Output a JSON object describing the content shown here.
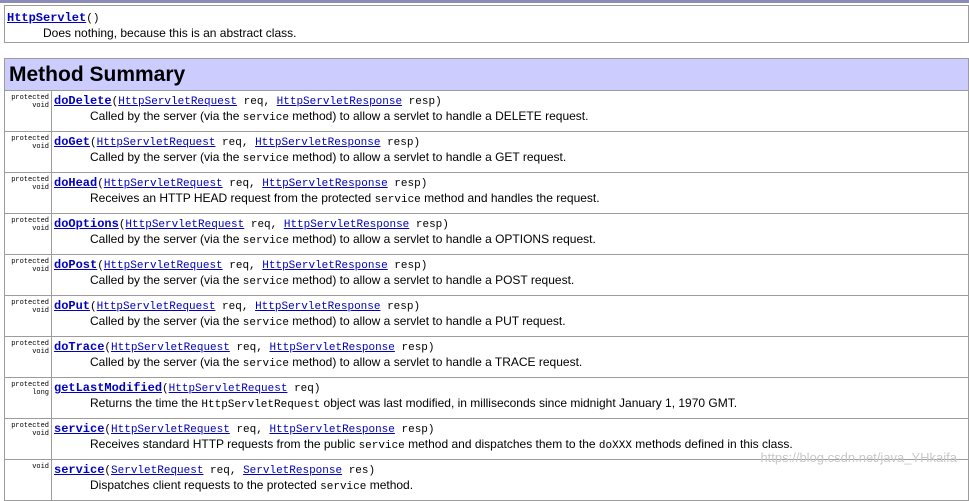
{
  "constructor": {
    "name": "HttpServlet",
    "params": "()",
    "description": "Does nothing, because this is an abstract class."
  },
  "summary_title": "Method Summary",
  "methods": [
    {
      "modifier": [
        "protected",
        "void"
      ],
      "name": "doDelete",
      "p1type": "HttpServletRequest",
      "p1name": " req, ",
      "p2type": "HttpServletResponse",
      "p2name": " resp)",
      "desc": [
        "Called by the server (via the ",
        "service",
        " method) to allow a servlet to handle a DELETE request."
      ]
    },
    {
      "modifier": [
        "protected",
        "void"
      ],
      "name": "doGet",
      "p1type": "HttpServletRequest",
      "p1name": " req, ",
      "p2type": "HttpServletResponse",
      "p2name": " resp)",
      "desc": [
        "Called by the server (via the ",
        "service",
        " method) to allow a servlet to handle a GET request."
      ]
    },
    {
      "modifier": [
        "protected",
        "void"
      ],
      "name": "doHead",
      "p1type": "HttpServletRequest",
      "p1name": " req, ",
      "p2type": "HttpServletResponse",
      "p2name": " resp)",
      "desc": [
        "Receives an HTTP HEAD request from the protected ",
        "service",
        " method and handles the request."
      ]
    },
    {
      "modifier": [
        "protected",
        "void"
      ],
      "name": "doOptions",
      "p1type": "HttpServletRequest",
      "p1name": " req, ",
      "p2type": "HttpServletResponse",
      "p2name": " resp)",
      "desc": [
        "Called by the server (via the ",
        "service",
        " method) to allow a servlet to handle a OPTIONS request."
      ]
    },
    {
      "modifier": [
        "protected",
        "void"
      ],
      "name": "doPost",
      "p1type": "HttpServletRequest",
      "p1name": " req, ",
      "p2type": "HttpServletResponse",
      "p2name": " resp)",
      "desc": [
        "Called by the server (via the ",
        "service",
        " method) to allow a servlet to handle a POST request."
      ]
    },
    {
      "modifier": [
        "protected",
        "void"
      ],
      "name": "doPut",
      "p1type": "HttpServletRequest",
      "p1name": " req, ",
      "p2type": "HttpServletResponse",
      "p2name": " resp)",
      "desc": [
        "Called by the server (via the ",
        "service",
        " method) to allow a servlet to handle a PUT request."
      ]
    },
    {
      "modifier": [
        "protected",
        "void"
      ],
      "name": "doTrace",
      "p1type": "HttpServletRequest",
      "p1name": " req, ",
      "p2type": "HttpServletResponse",
      "p2name": " resp)",
      "desc": [
        "Called by the server (via the ",
        "service",
        " method) to allow a servlet to handle a TRACE request."
      ]
    },
    {
      "modifier": [
        "protected",
        "long"
      ],
      "name": "getLastModified",
      "p1type": "HttpServletRequest",
      "p1name": " req)",
      "p2type": "",
      "p2name": "",
      "desc": [
        "Returns the time the ",
        "HttpServletRequest",
        " object was last modified, in milliseconds since midnight January 1, 1970 GMT."
      ]
    },
    {
      "modifier": [
        "protected",
        "void"
      ],
      "name": "service",
      "p1type": "HttpServletRequest",
      "p1name": " req, ",
      "p2type": "HttpServletResponse",
      "p2name": " resp)",
      "desc": [
        "Receives standard HTTP requests from the public ",
        "service",
        " method and dispatches them to the ",
        "doXXX",
        " methods defined in this class."
      ]
    },
    {
      "modifier": [
        "",
        "void"
      ],
      "name": "service",
      "p1type": "ServletRequest",
      "p1name": " req, ",
      "p2type": "ServletResponse",
      "p2name": " res)",
      "desc": [
        "Dispatches client requests to the protected ",
        "service",
        " method."
      ]
    }
  ],
  "watermark": "https://blog.csdn.net/java_YHkaifa"
}
